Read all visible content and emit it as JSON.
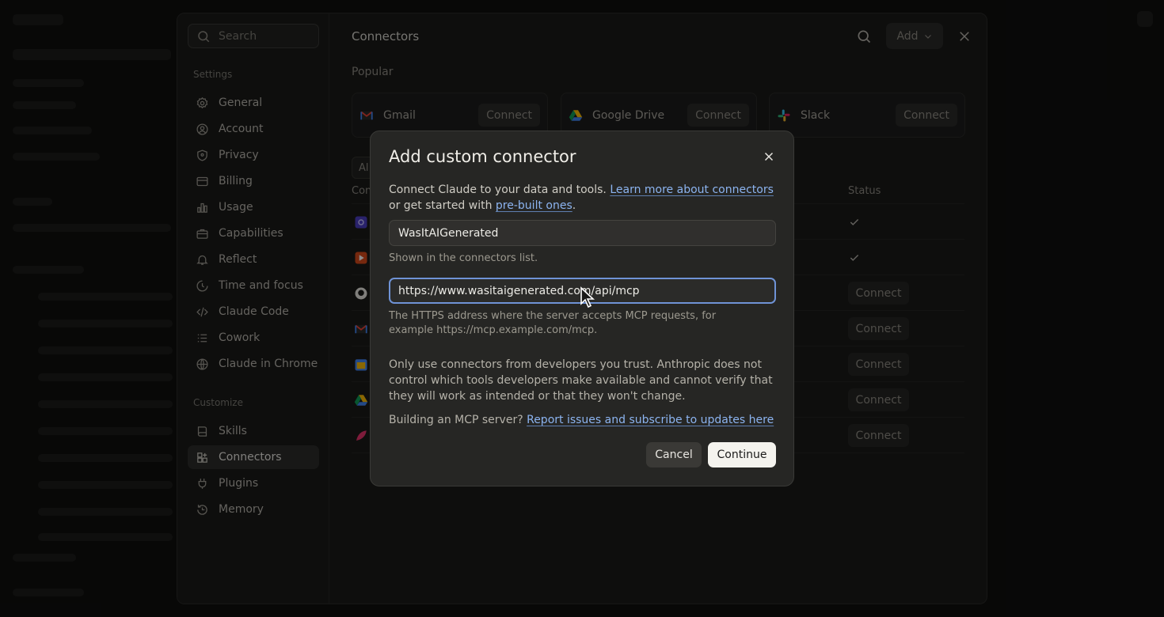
{
  "sidebar": {
    "search_placeholder": "Search",
    "settings_label": "Settings",
    "settings_items": [
      {
        "label": "General",
        "icon": "gear-icon"
      },
      {
        "label": "Account",
        "icon": "user-circle-icon"
      },
      {
        "label": "Privacy",
        "icon": "shield-icon"
      },
      {
        "label": "Billing",
        "icon": "card-icon"
      },
      {
        "label": "Usage",
        "icon": "bar-chart-icon"
      },
      {
        "label": "Capabilities",
        "icon": "briefcase-icon"
      },
      {
        "label": "Reflect",
        "icon": "bell-icon"
      },
      {
        "label": "Time and focus",
        "icon": "clock-icon"
      },
      {
        "label": "Claude Code",
        "icon": "code-icon"
      },
      {
        "label": "Cowork",
        "icon": "list-icon"
      },
      {
        "label": "Claude in Chrome",
        "icon": "globe-icon"
      }
    ],
    "customize_label": "Customize",
    "customize_items": [
      {
        "label": "Skills",
        "icon": "book-icon"
      },
      {
        "label": "Connectors",
        "icon": "grid-plus-icon",
        "active": true
      },
      {
        "label": "Plugins",
        "icon": "plug-icon"
      },
      {
        "label": "Memory",
        "icon": "history-icon"
      }
    ]
  },
  "main": {
    "title": "Connectors",
    "add_label": "Add",
    "popular_label": "Popular",
    "popular": [
      {
        "name": "Gmail",
        "action": "Connect",
        "icon": "gmail-icon"
      },
      {
        "name": "Google Drive",
        "action": "Connect",
        "icon": "google-drive-icon"
      },
      {
        "name": "Slack",
        "action": "Connect",
        "icon": "slack-icon"
      }
    ],
    "filter_label": "Al",
    "table_header_left": "Con",
    "table_header_status": "Status",
    "rows": [
      {
        "icon": "purple-app-icon",
        "status": "check"
      },
      {
        "icon": "play-icon",
        "status": "check"
      },
      {
        "icon": "github-icon",
        "status": "Connect"
      },
      {
        "icon": "gmail-icon",
        "status": "Connect"
      },
      {
        "icon": "calendar-icon",
        "status": "Connect"
      },
      {
        "icon": "google-drive-icon",
        "status": "Connect"
      },
      {
        "icon": "feather-icon",
        "status": "Connect"
      }
    ]
  },
  "dialog": {
    "title": "Add custom connector",
    "desc_prefix": "Connect Claude to your data and tools. ",
    "desc_link1": "Learn more about connectors",
    "desc_mid": " or get started with ",
    "desc_link2": "pre-built ones",
    "desc_suffix": ".",
    "name_value": "WasItAIGenerated",
    "name_helper": "Shown in the connectors list.",
    "url_value": "https://www.wasitaigenerated.com/api/mcp",
    "url_helper": "The HTTPS address where the server accepts MCP requests, for example https://mcp.example.com/mcp.",
    "warning": "Only use connectors from developers you trust. Anthropic does not control which tools developers make available and cannot verify that they will work as intended or that they won't change.",
    "building_prefix": "Building an MCP server? ",
    "building_link": "Report issues and subscribe to updates here",
    "cancel_label": "Cancel",
    "continue_label": "Continue"
  },
  "colors": {
    "accent_link": "#8cb4f0",
    "focus_ring": "#6f93d6",
    "panel_bg": "#1a1a19",
    "dialog_bg": "#262624"
  }
}
